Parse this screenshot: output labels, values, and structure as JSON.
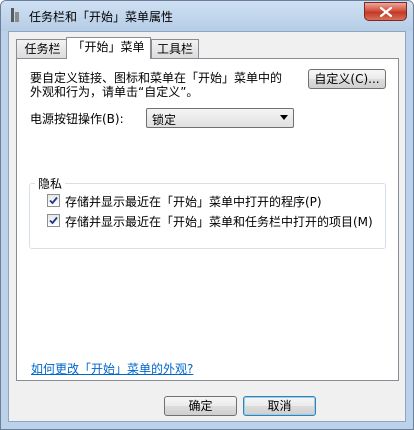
{
  "window": {
    "title": "任务栏和「开始」菜单属性"
  },
  "tabs": [
    {
      "label": "任务栏",
      "active": false
    },
    {
      "label": "「开始」菜单",
      "active": true
    },
    {
      "label": "工具栏",
      "active": false
    }
  ],
  "start_menu": {
    "description_line1": "要自定义链接、图标和菜单在「开始」菜单中的",
    "description_line2": "外观和行为，请单击“自定义”。",
    "customize_button": "自定义(C)...",
    "power_button_label": "电源按钮操作(B):",
    "power_button_value": "锁定",
    "privacy": {
      "title": "隐私",
      "options": [
        {
          "label": "存储并显示最近在「开始」菜单中打开的程序(P)",
          "checked": true
        },
        {
          "label": "存储并显示最近在「开始」菜单和任务栏中打开的项目(M)",
          "checked": true
        }
      ]
    },
    "help_link": "如何更改「开始」菜单的外观?"
  },
  "footer": {
    "ok_label": "确定",
    "cancel_label": "取消"
  },
  "icons": {
    "app_icon": "window-icon",
    "close_icon": "close-icon",
    "dropdown_icon": "chevron-down-icon",
    "check_icon": "check-icon"
  }
}
